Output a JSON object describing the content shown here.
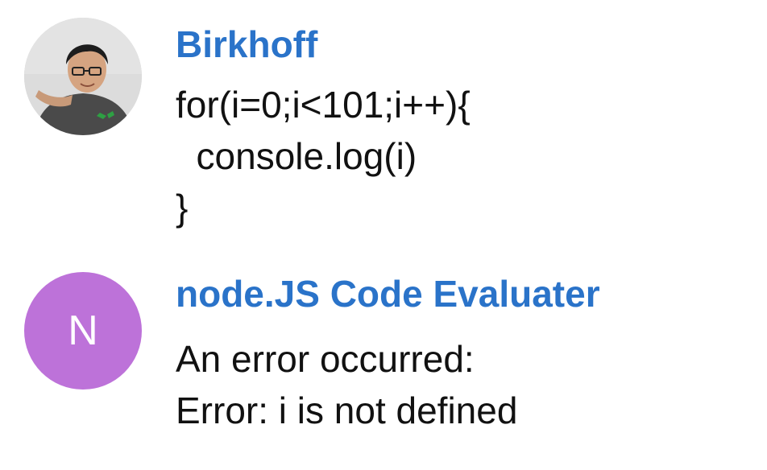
{
  "messages": [
    {
      "sender": "Birkhoff",
      "text": "for(i=0;i<101;i++){\n  console.log(i)\n}",
      "avatar": {
        "type": "photo",
        "icon": "user-photo-avatar"
      }
    },
    {
      "sender": "node.JS Code Evaluater",
      "text": "An error occurred:\nError: i is not defined",
      "avatar": {
        "type": "initial",
        "initial": "N",
        "color": "#bd72d9"
      }
    }
  ],
  "colors": {
    "sender_name": "#2a73c9",
    "message_text": "#111111",
    "background": "#ffffff"
  }
}
